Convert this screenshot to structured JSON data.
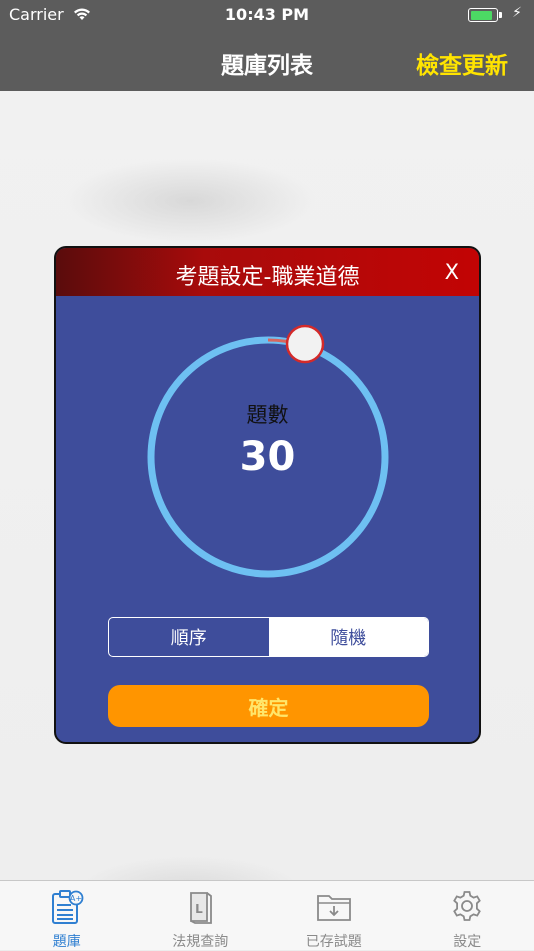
{
  "status_bar": {
    "carrier": "Carrier",
    "time": "10:43 PM",
    "battery_level": 0.9,
    "battery_color": "#4cd964"
  },
  "nav": {
    "title": "題庫列表",
    "right_action": "檢查更新",
    "right_action_color": "#ffe400",
    "background": "#5c5c5c"
  },
  "dialog": {
    "title": "考題設定-職業道德",
    "close_label": "X",
    "counter": {
      "label": "題數",
      "value": "30"
    },
    "order_options": [
      "順序",
      "隨機"
    ],
    "selected_order": "隨機",
    "confirm_label": "確定",
    "colors": {
      "body": "#3e4d9b",
      "header": "#c20404",
      "ring": "#6ec0f2",
      "confirm": "#ff9500"
    }
  },
  "tabbar": {
    "tabs": [
      {
        "label": "題庫",
        "icon": "question-bank-icon",
        "active": true
      },
      {
        "label": "法規查詢",
        "icon": "law-book-icon",
        "active": false
      },
      {
        "label": "已存試題",
        "icon": "saved-folder-icon",
        "active": false
      },
      {
        "label": "設定",
        "icon": "gear-icon",
        "active": false
      }
    ]
  }
}
